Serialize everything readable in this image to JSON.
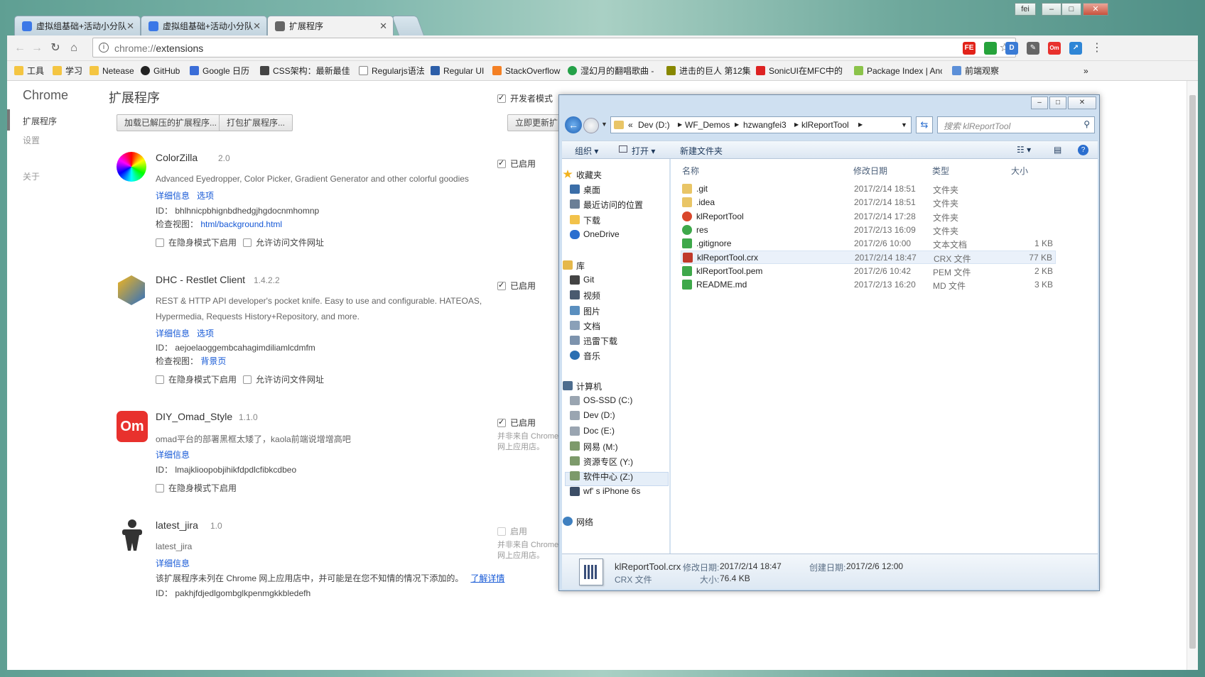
{
  "window": {
    "controls": [
      "fei",
      "–",
      "□",
      "✕"
    ]
  },
  "tabs": [
    {
      "label": "虚拟组基础+活动小分队",
      "close": "✕"
    },
    {
      "label": "虚拟组基础+活动小分队",
      "close": "✕"
    },
    {
      "label": "扩展程序",
      "close": "✕"
    }
  ],
  "toolbar": {
    "url_scheme": "chrome://",
    "url_path": "extensions",
    "info_icon": "i",
    "back": "←",
    "forward": "→",
    "reload": "↻",
    "home": "⌂",
    "star": "☆",
    "menu": "⋮",
    "ext_icons": [
      {
        "name": "fe",
        "text": "FE",
        "color": "#e2231a"
      },
      {
        "name": "green-square",
        "text": "",
        "color": "#26a33b"
      },
      {
        "name": "d",
        "text": "D",
        "color": "#3a7bd5"
      },
      {
        "name": "eyedropper",
        "text": "✎",
        "color": "#666666"
      },
      {
        "name": "om",
        "text": "Om",
        "color": "#e8312d"
      },
      {
        "name": "arrow",
        "text": "↗",
        "color": "#2f86d6"
      }
    ]
  },
  "bookmarks": [
    {
      "label": "工具",
      "color": "#f4c542"
    },
    {
      "label": "学习",
      "color": "#f4c542"
    },
    {
      "label": "Netease",
      "color": "#f4c542"
    },
    {
      "label": "GitHub",
      "color": "#222222"
    },
    {
      "label": "Google 日历",
      "color": "#3b6ed8"
    },
    {
      "label": "CSS架构：最新最佳",
      "color": "#444444"
    },
    {
      "label": "Regularjs语法",
      "color": "#ffffff"
    },
    {
      "label": "Regular UI",
      "color": "#2c5ea8"
    },
    {
      "label": "StackOverflow",
      "color": "#f48024"
    },
    {
      "label": "湿幻月的翻唱歌曲 -",
      "color": "#24a148"
    },
    {
      "label": "进击的巨人 第12集",
      "color": "#888800"
    },
    {
      "label": "SonicUI在MFC中的",
      "color": "#d22"
    },
    {
      "label": "Package Index | Anc",
      "color": "#8bc34a"
    },
    {
      "label": "前端观察",
      "color": "#5b8fd8"
    }
  ],
  "bookmarks_overflow": "»",
  "sidebar": {
    "title": "Chrome",
    "items": [
      {
        "label": "扩展程序",
        "selected": true
      },
      {
        "label": "设置",
        "selected": false
      },
      {
        "label": "关于",
        "selected": false
      }
    ]
  },
  "main": {
    "title": "扩展程序",
    "dev_mode_label": "开发者模式",
    "buttons": {
      "load_unpacked": "加载已解压的扩展程序...",
      "pack": "打包扩展程序...",
      "update": "立即更新扩"
    },
    "extensions": [
      {
        "name": "ColorZilla",
        "version": "2.0",
        "desc": [
          "Advanced Eyedropper, Color Picker, Gradient Generator and other colorful goodies"
        ],
        "links": [
          "详细信息",
          "选项"
        ],
        "id_label": "ID：",
        "id": "bhlhnicpbhignbdhedgjhgdocnmhomnp",
        "inspect_label": "检查视图：",
        "inspect": "html/background.html",
        "options": [
          "在隐身模式下启用",
          "允许访问文件网址"
        ],
        "enabled_label": "已启用",
        "enabled": true,
        "note": []
      },
      {
        "name": "DHC - Restlet Client",
        "version": "1.4.2.2",
        "desc": [
          "REST & HTTP API developer's pocket knife. Easy to use and configurable. HATEOAS,",
          "Hypermedia, Requests History+Repository, and more."
        ],
        "links": [
          "详细信息",
          "选项"
        ],
        "id_label": "ID：",
        "id": "aejoelaoggembcahagimdiliamlcdmfm",
        "inspect_label": "检查视图：",
        "inspect": "背景页",
        "options": [
          "在隐身模式下启用",
          "允许访问文件网址"
        ],
        "enabled_label": "已启用",
        "enabled": true,
        "note": []
      },
      {
        "name": "DIY_Omad_Style",
        "version": "1.1.0",
        "desc": [
          "omad平台的部署黑框太矮了，kaola前端说增增高吧"
        ],
        "links": [
          "详细信息"
        ],
        "id_label": "ID：",
        "id": "lmajklioopobjihikfdpdlcfibkcdbeo",
        "options": [
          "在隐身模式下启用"
        ],
        "enabled_label": "已启用",
        "enabled": true,
        "note": [
          "并非来自 Chrome",
          "网上应用店。"
        ]
      },
      {
        "name": "latest_jira",
        "version": "1.0",
        "desc": [
          "latest_jira"
        ],
        "links": [
          "详细信息"
        ],
        "warning": "该扩展程序未列在 Chrome 网上应用店中，并可能是在您不知情的情况下添加的。",
        "learn_more": "了解详情",
        "id_label": "ID：",
        "id": "pakhjfdjedlgombglkpenmgkkbledefh",
        "enabled_label": "启用",
        "enabled": false,
        "note": [
          "并非来自 Chrome",
          "网上应用店。"
        ]
      }
    ]
  },
  "explorer": {
    "controls": [
      "–",
      "□",
      "✕"
    ],
    "breadcrumb": [
      "«",
      "Dev (D:)",
      "WF_Demos",
      "hzwangfei3",
      "klReportTool"
    ],
    "search_placeholder": "搜索 klReportTool",
    "commands": {
      "organize": "组织 ▾",
      "open": "打开 ▾",
      "new_folder": "新建文件夹"
    },
    "nav": [
      {
        "label": "收藏夹",
        "group": true,
        "color": "#f2b21c"
      },
      {
        "label": "桌面",
        "group": false,
        "color": "#3b6ea8"
      },
      {
        "label": "最近访问的位置",
        "group": false,
        "color": "#6b7f96"
      },
      {
        "label": "下载",
        "group": false,
        "color": "#f2c24a"
      },
      {
        "label": "OneDrive",
        "group": false,
        "color": "#2a6ecf"
      },
      {
        "label": "库",
        "group": true,
        "color": "#e5b84b"
      },
      {
        "label": "Git",
        "group": false,
        "color": "#444444"
      },
      {
        "label": "视频",
        "group": false,
        "color": "#4a5a6f"
      },
      {
        "label": "图片",
        "group": false,
        "color": "#5a8fbf"
      },
      {
        "label": "文档",
        "group": false,
        "color": "#8aa0b8"
      },
      {
        "label": "迅雷下载",
        "group": false,
        "color": "#7d93ad"
      },
      {
        "label": "音乐",
        "group": false,
        "color": "#2b6fb2"
      },
      {
        "label": "计算机",
        "group": true,
        "color": "#4d6d8f"
      },
      {
        "label": "OS-SSD (C:)",
        "group": false,
        "color": "#9aa5b1"
      },
      {
        "label": "Dev (D:)",
        "group": false,
        "color": "#9aa5b1"
      },
      {
        "label": "Doc (E:)",
        "group": false,
        "color": "#9aa5b1"
      },
      {
        "label": "网易 (M:)",
        "group": false,
        "color": "#7d9a6b"
      },
      {
        "label": "资源专区 (Y:)",
        "group": false,
        "color": "#7d9a6b"
      },
      {
        "label": "软件中心 (Z:)",
        "group": false,
        "color": "#7d9a6b"
      },
      {
        "label": "wf' s iPhone 6s",
        "group": false,
        "color": "#3c4e66"
      },
      {
        "label": "网络",
        "group": true,
        "color": "#3f80c0"
      }
    ],
    "columns": [
      "名称",
      "修改日期",
      "类型",
      "大小"
    ],
    "files": [
      {
        "name": ".git",
        "date": "2017/2/14 18:51",
        "type": "文件夹",
        "size": "",
        "icon": "#e9c566"
      },
      {
        "name": ".idea",
        "date": "2017/2/14 18:51",
        "type": "文件夹",
        "size": "",
        "icon": "#e9c566"
      },
      {
        "name": "klReportTool",
        "date": "2017/2/14 17:28",
        "type": "文件夹",
        "size": "",
        "icon": "#d9472b"
      },
      {
        "name": "res",
        "date": "2017/2/13 16:09",
        "type": "文件夹",
        "size": "",
        "icon": "#3ea84a"
      },
      {
        "name": ".gitignore",
        "date": "2017/2/6 10:00",
        "type": "文本文档",
        "size": "1 KB",
        "icon": "#3ea84a"
      },
      {
        "name": "klReportTool.crx",
        "date": "2017/2/14 18:47",
        "type": "CRX 文件",
        "size": "77 KB",
        "icon": "#c0392b"
      },
      {
        "name": "klReportTool.pem",
        "date": "2017/2/6 10:42",
        "type": "PEM 文件",
        "size": "2 KB",
        "icon": "#3ea84a"
      },
      {
        "name": "README.md",
        "date": "2017/2/13 16:20",
        "type": "MD 文件",
        "size": "3 KB",
        "icon": "#3ea84a"
      }
    ],
    "details": {
      "name": "klReportTool.crx",
      "type": "CRX 文件",
      "modified_label": "修改日期:",
      "modified": "2017/2/14 18:47",
      "size_label": "大小:",
      "size": "76.4 KB",
      "created_label": "创建日期:",
      "created": "2017/2/6 12:00"
    }
  }
}
